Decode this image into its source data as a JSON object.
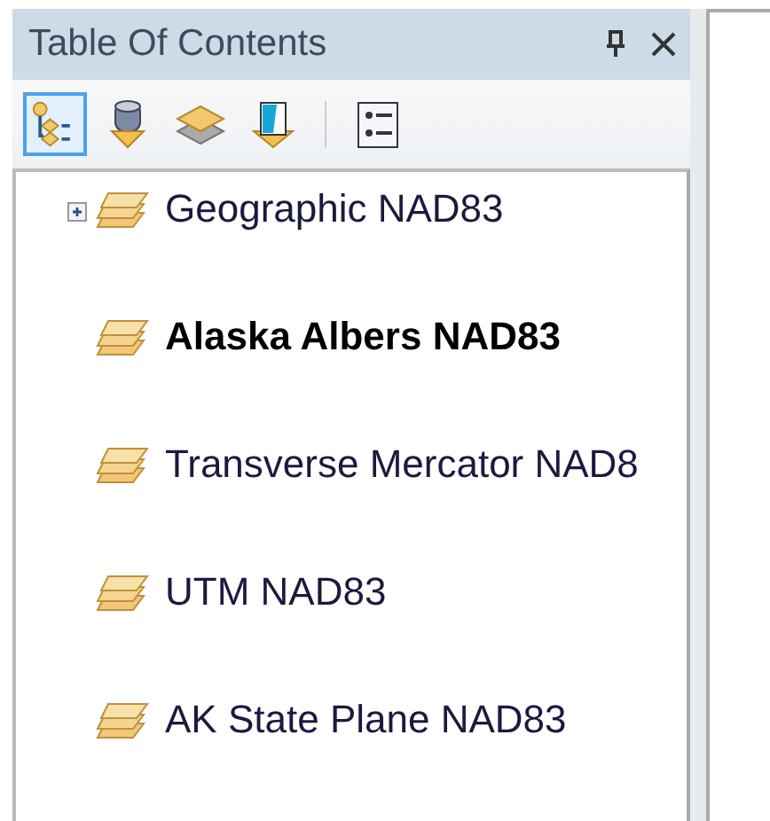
{
  "panel": {
    "title": "Table Of Contents"
  },
  "toolbar": [
    {
      "kind": "drawing-order",
      "selected": true
    },
    {
      "kind": "source",
      "selected": false
    },
    {
      "kind": "visibility",
      "selected": false
    },
    {
      "kind": "selection",
      "selected": false
    },
    {
      "kind": "options",
      "selected": false
    }
  ],
  "tree": [
    {
      "label": "Geographic NAD83",
      "active": false,
      "expanded": false
    },
    {
      "label": "Alaska Albers NAD83",
      "active": true
    },
    {
      "label": "Transverse Mercator NAD8",
      "active": false
    },
    {
      "label": "UTM NAD83",
      "active": false
    },
    {
      "label": "AK State Plane NAD83",
      "active": false
    }
  ]
}
